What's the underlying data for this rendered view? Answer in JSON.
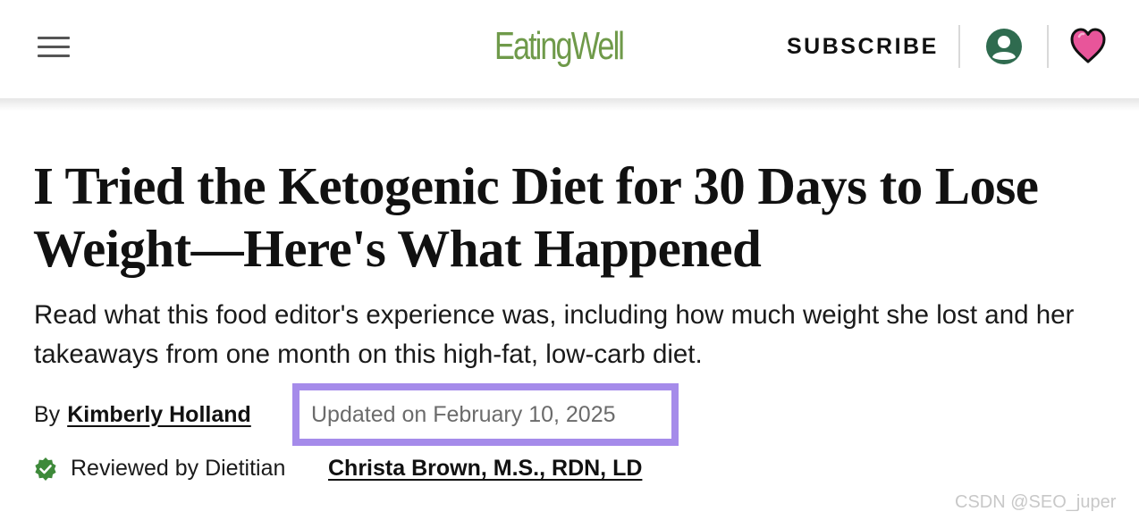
{
  "header": {
    "menu_icon": "hamburger-menu-icon",
    "logo_text": "EatingWell",
    "subscribe_label": "SUBSCRIBE",
    "account_icon": "user-account-icon",
    "favorites_icon": "heart-icon",
    "colors": {
      "logo": "#6f9a4a",
      "account": "#2f6b4f",
      "heart_fill": "#e8559a",
      "heart_outline": "#111111"
    }
  },
  "article": {
    "title": "I Tried the Ketogenic Diet for 30 Days to Lose Weight—Here's What Happened",
    "dek": "Read what this food editor's experience was, including how much weight she lost and her takeaways from one month on this high-fat, low-carb diet.",
    "byline_prefix": "By",
    "author": "Kimberly Holland",
    "updated": "Updated on February 10, 2025",
    "review_label": "Reviewed by Dietitian",
    "reviewer": "Christa Brown, M.S., RDN, LD",
    "review_icon": "verified-check-icon",
    "colors": {
      "highlight_border": "#a58bea",
      "verified_badge": "#3e8a3a"
    }
  },
  "watermark": "CSDN @SEO_juper"
}
